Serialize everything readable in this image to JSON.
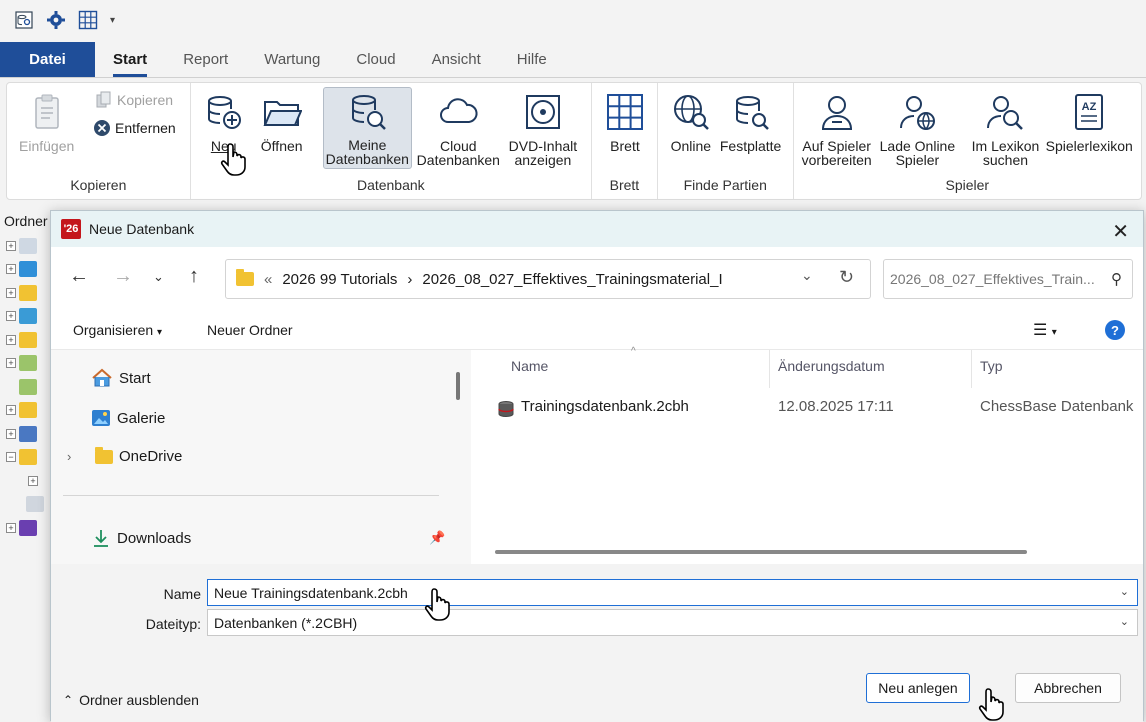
{
  "quick_access": {
    "icons": [
      "database-search-icon",
      "gear-icon",
      "grid-icon",
      "dropdown-arrow-icon"
    ]
  },
  "tabs": [
    "Datei",
    "Start",
    "Report",
    "Wartung",
    "Cloud",
    "Ansicht",
    "Hilfe"
  ],
  "ribbon": {
    "kopieren": {
      "einfuegen": "Einfügen",
      "kopieren": "Kopieren",
      "entfernen": "Entfernen",
      "label": "Kopieren"
    },
    "datenbank": {
      "neu": "Neu",
      "oeffnen": "Öffnen",
      "meine_1": "Meine",
      "meine_2": "Datenbanken",
      "cloud_1": "Cloud",
      "cloud_2": "Datenbanken",
      "dvd_1": "DVD-Inhalt",
      "dvd_2": "anzeigen",
      "label": "Datenbank"
    },
    "brett": {
      "brett": "Brett",
      "label": "Brett"
    },
    "partien": {
      "online": "Online",
      "festplatte": "Festplatte",
      "label": "Finde Partien"
    },
    "spieler": {
      "auf_1": "Auf Spieler",
      "auf_2": "vorbereiten",
      "lade_1": "Lade Online",
      "lade_2": "Spieler",
      "lex_1": "Im Lexikon",
      "lex_2": "suchen",
      "spielerlexikon": "Spielerlexikon",
      "label": "Spieler"
    }
  },
  "left_panel": {
    "header": "Ordner"
  },
  "dialog": {
    "logo": "'26",
    "title": "Neue Datenbank",
    "breadcrumb": {
      "prefix": "«",
      "part1": "2026 99 Tutorials",
      "sep": "›",
      "part2": "2026_08_027_Effektives_Trainingsmaterial_I"
    },
    "search_placeholder": "2026_08_027_Effektives_Train...",
    "organisieren": "Organisieren",
    "neuer_ordner": "Neuer Ordner",
    "nav": {
      "start": "Start",
      "galerie": "Galerie",
      "onedrive": "OneDrive",
      "downloads": "Downloads"
    },
    "columns": {
      "name": "Name",
      "date": "Änderungsdatum",
      "type": "Typ"
    },
    "files": [
      {
        "name": "Trainingsdatenbank.2cbh",
        "date": "12.08.2025 17:11",
        "type": "ChessBase Datenbank"
      }
    ],
    "name_label": "Name",
    "name_value": "Neue Trainingsdatenbank.2cbh",
    "type_label": "Dateityp:",
    "type_value": "Datenbanken (*.2CBH)",
    "hide_folders": "Ordner ausblenden",
    "create_button": "Neu anlegen",
    "cancel_button": "Abbrechen"
  },
  "colors": {
    "accent": "#1f4e99",
    "focus": "#1f6fd6",
    "logo": "#c4161c"
  }
}
